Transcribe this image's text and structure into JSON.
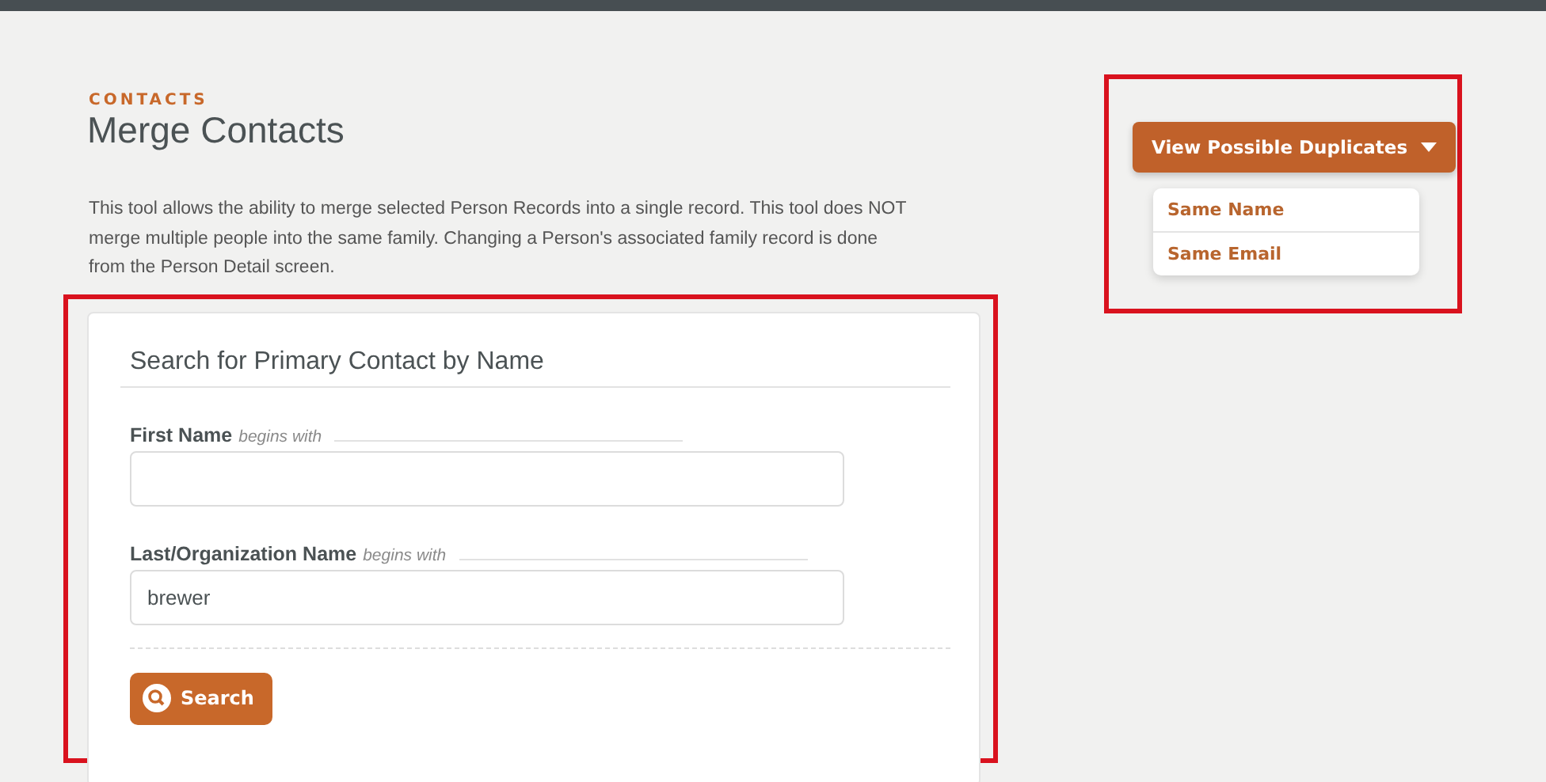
{
  "header": {
    "eyebrow": "CONTACTS",
    "title": "Merge Contacts"
  },
  "description": "This tool allows the ability to merge selected Person Records into a single record. This tool does NOT merge multiple people into the same family. Changing a Person's associated family record is done from the Person Detail screen.",
  "search_form": {
    "title": "Search for Primary Contact by Name",
    "fields": [
      {
        "label": "First Name",
        "hint": "begins with"
      },
      {
        "label": "Last/Organization Name",
        "hint": "begins with",
        "value": "brewer"
      }
    ],
    "button": "Search"
  },
  "duplicates": {
    "button": "View Possible Duplicates",
    "expanded": true,
    "items": [
      {
        "label": "Same Name"
      },
      {
        "label": "Same Email"
      }
    ]
  }
}
